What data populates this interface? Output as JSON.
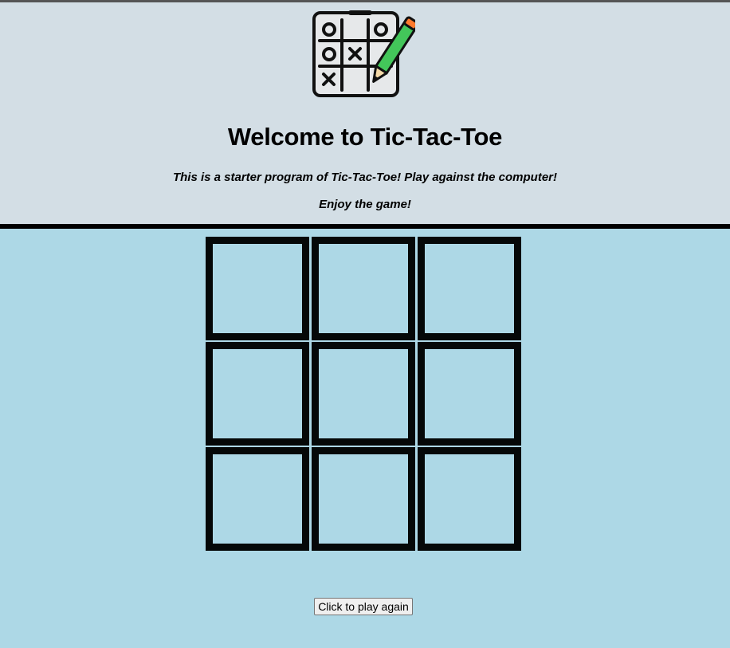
{
  "header": {
    "title": "Welcome to Tic-Tac-Toe",
    "intro_line1": "This is a starter program of Tic-Tac-Toe! Play against the computer!",
    "intro_line2": "Enjoy the game!",
    "logo_icon": "tic-tac-toe-pencil-icon"
  },
  "board": {
    "cells": [
      "",
      "",
      "",
      "",
      "",
      "",
      "",
      "",
      ""
    ]
  },
  "controls": {
    "play_again_label": "Click to play again"
  },
  "colors": {
    "header_bg": "#d3dee5",
    "page_bg": "#add8e6",
    "cell_border": "#050808"
  }
}
